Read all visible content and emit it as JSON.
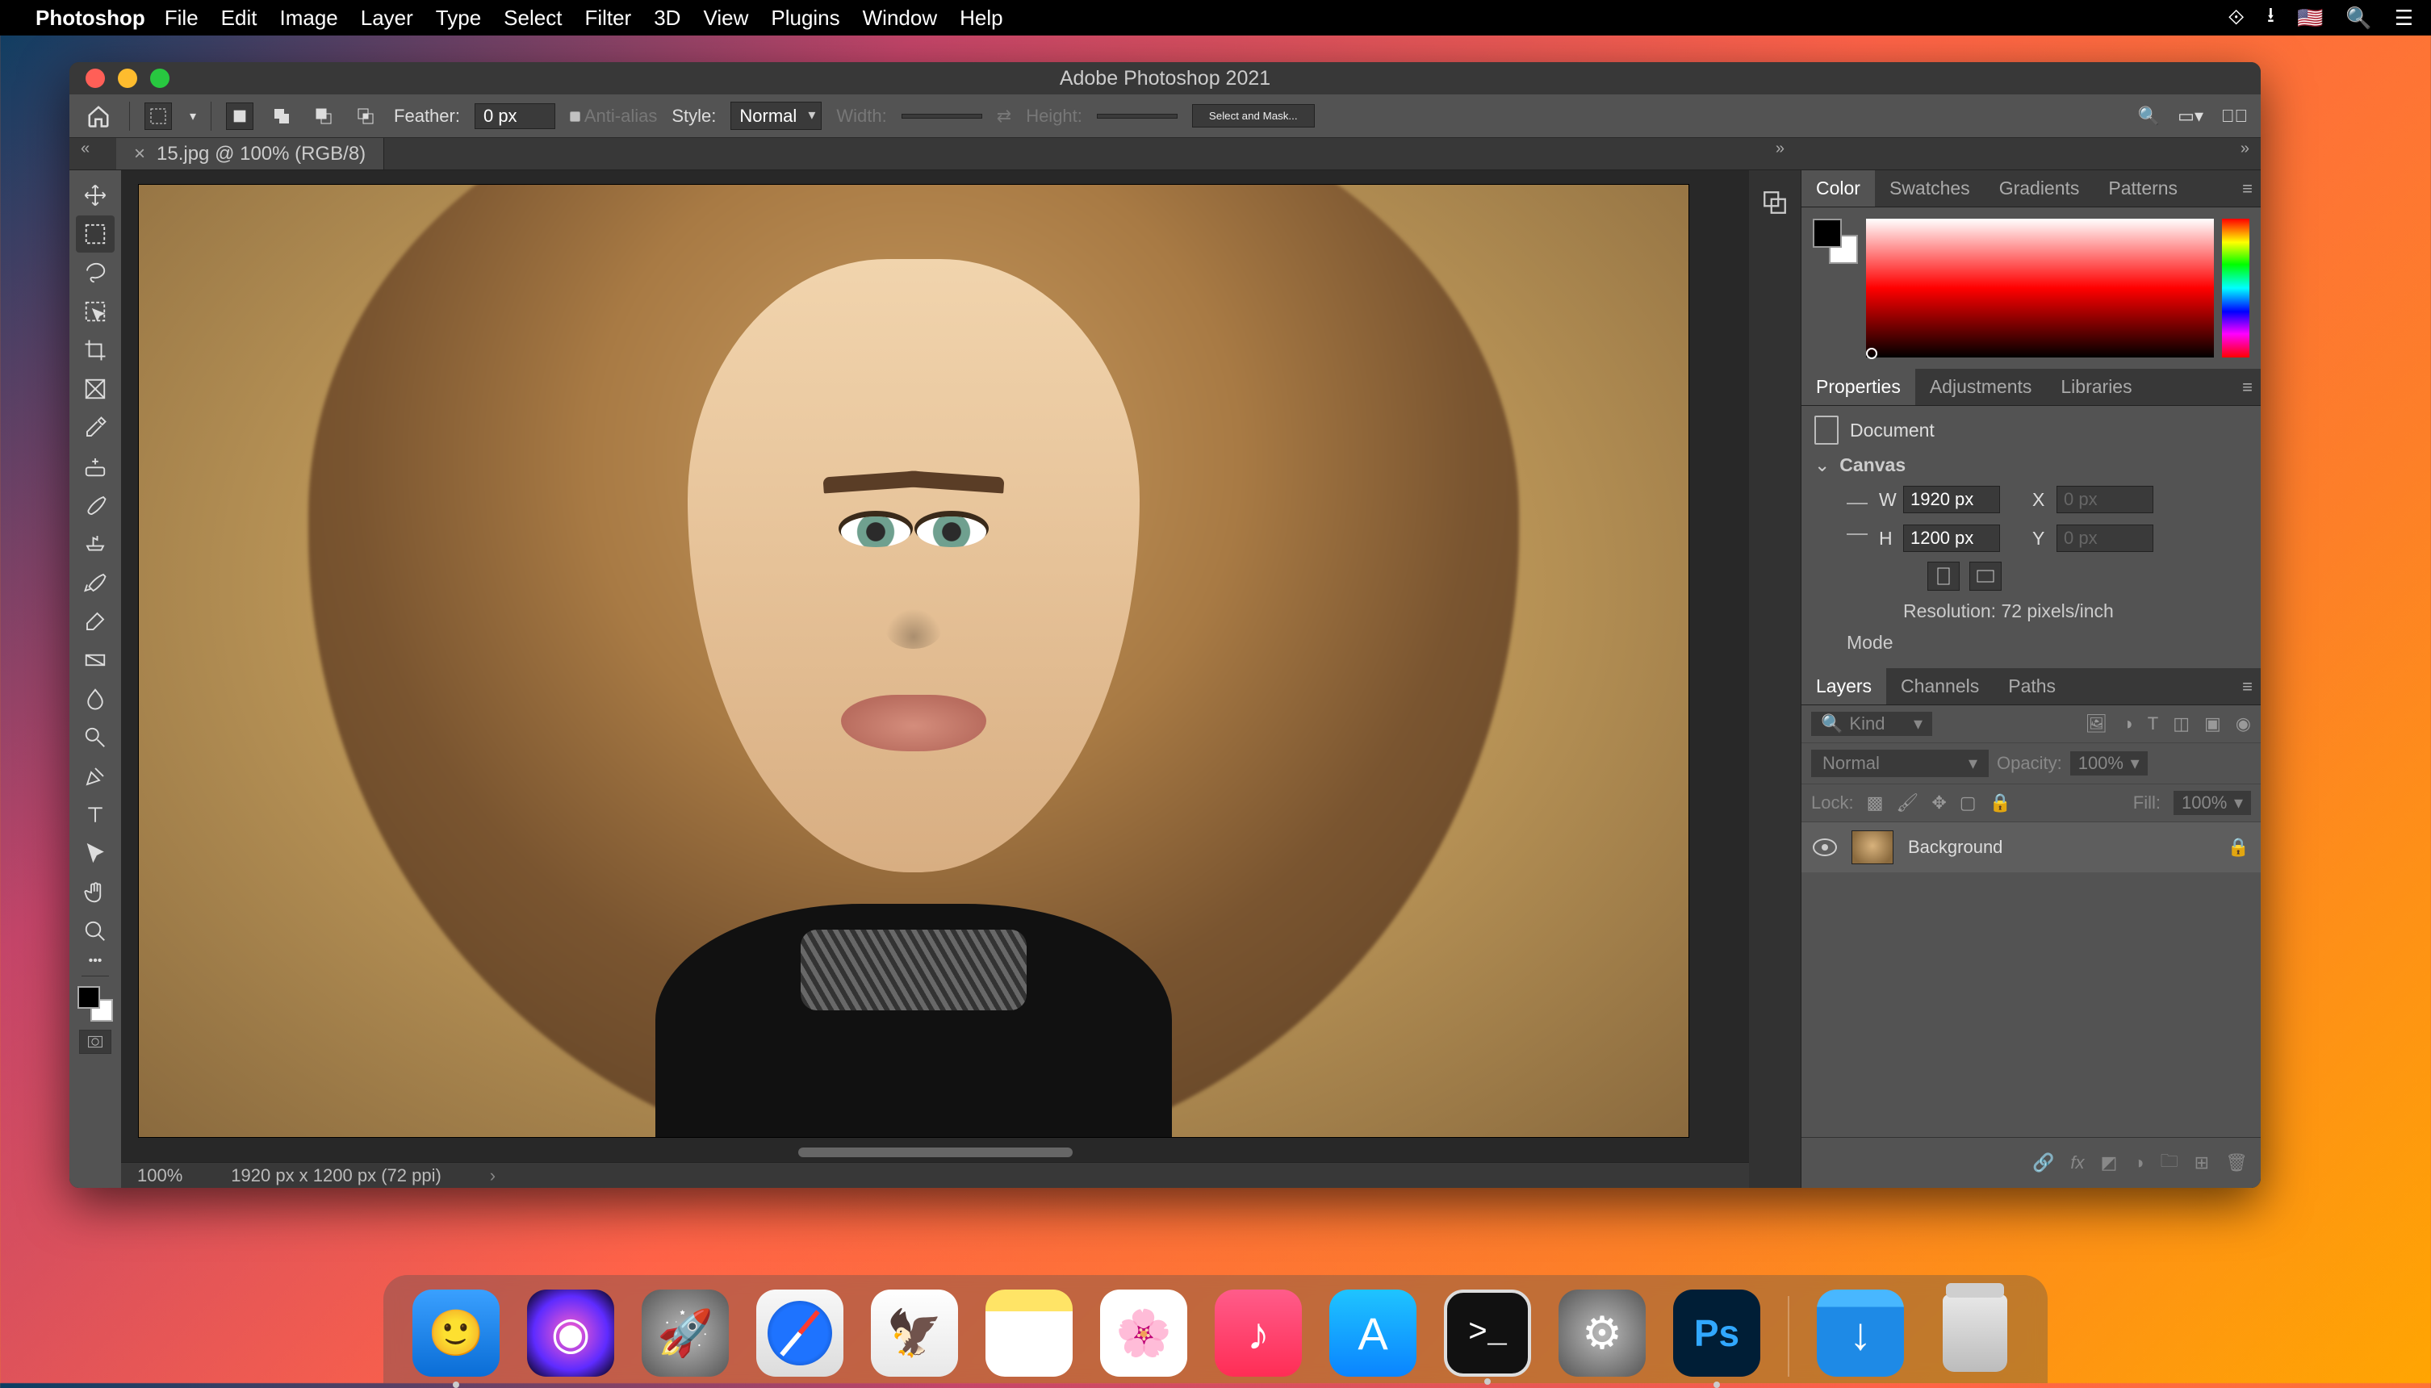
{
  "macos": {
    "app": "Photoshop",
    "menus": [
      "File",
      "Edit",
      "Image",
      "Layer",
      "Type",
      "Select",
      "Filter",
      "3D",
      "View",
      "Plugins",
      "Window",
      "Help"
    ]
  },
  "window": {
    "title": "Adobe Photoshop 2021"
  },
  "options": {
    "feather_label": "Feather:",
    "feather_value": "0 px",
    "antialias": "Anti-alias",
    "style_label": "Style:",
    "style_value": "Normal",
    "width_label": "Width:",
    "height_label": "Height:",
    "select_mask": "Select and Mask..."
  },
  "document": {
    "tab": "15.jpg @ 100% (RGB/8)",
    "zoom": "100%",
    "dims": "1920 px x 1200 px (72 ppi)"
  },
  "color_tabs": [
    "Color",
    "Swatches",
    "Gradients",
    "Patterns"
  ],
  "props_tabs": [
    "Properties",
    "Adjustments",
    "Libraries"
  ],
  "properties": {
    "doc_label": "Document",
    "canvas_label": "Canvas",
    "W": "W",
    "H": "H",
    "X": "X",
    "Y": "Y",
    "w_val": "1920 px",
    "h_val": "1200 px",
    "x_val": "0 px",
    "y_val": "0 px",
    "resolution": "Resolution: 72 pixels/inch",
    "mode": "Mode"
  },
  "layers_tabs": [
    "Layers",
    "Channels",
    "Paths"
  ],
  "layers": {
    "kind_placeholder": "Kind",
    "blend": "Normal",
    "opacity_label": "Opacity:",
    "opacity_val": "100%",
    "lock_label": "Lock:",
    "fill_label": "Fill:",
    "fill_val": "100%",
    "layer_name": "Background"
  },
  "dock": {
    "apps": [
      "finder",
      "siri",
      "launchpad",
      "safari",
      "mail",
      "notes",
      "photos",
      "music",
      "appstore",
      "terminal",
      "settings",
      "photoshop"
    ],
    "ps_label": "Ps",
    "term_label": ">_",
    "downloads_label": "↓"
  }
}
